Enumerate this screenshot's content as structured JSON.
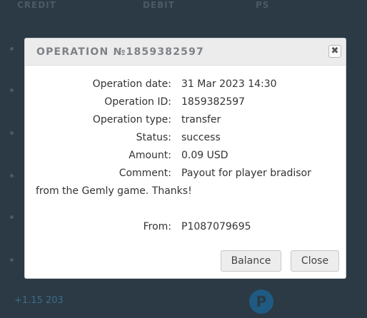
{
  "background": {
    "columns": [
      "CREDIT",
      "DEBIT",
      "PS"
    ],
    "bottom_text": "+1.15 203",
    "ps_icon_letter": "P"
  },
  "modal": {
    "title": "OPERATION №1859382597",
    "close_glyph": "✖",
    "fields": {
      "date_label": "Operation date:",
      "date_value": "31 Mar 2023 14:30",
      "id_label": "Operation ID:",
      "id_value": "1859382597",
      "type_label": "Operation type:",
      "type_value": "transfer",
      "status_label": "Status:",
      "status_value": "success",
      "amount_label": "Amount:",
      "amount_value": "0.09 USD",
      "comment_label": "Comment:",
      "comment_value_line1": "Payout for player bradisor",
      "comment_value_line2": "from the Gemly game. Thanks!",
      "from_label": "From:",
      "from_value": "P1087079695"
    },
    "buttons": {
      "balance_label": "Balance",
      "close_label": "Close"
    }
  }
}
